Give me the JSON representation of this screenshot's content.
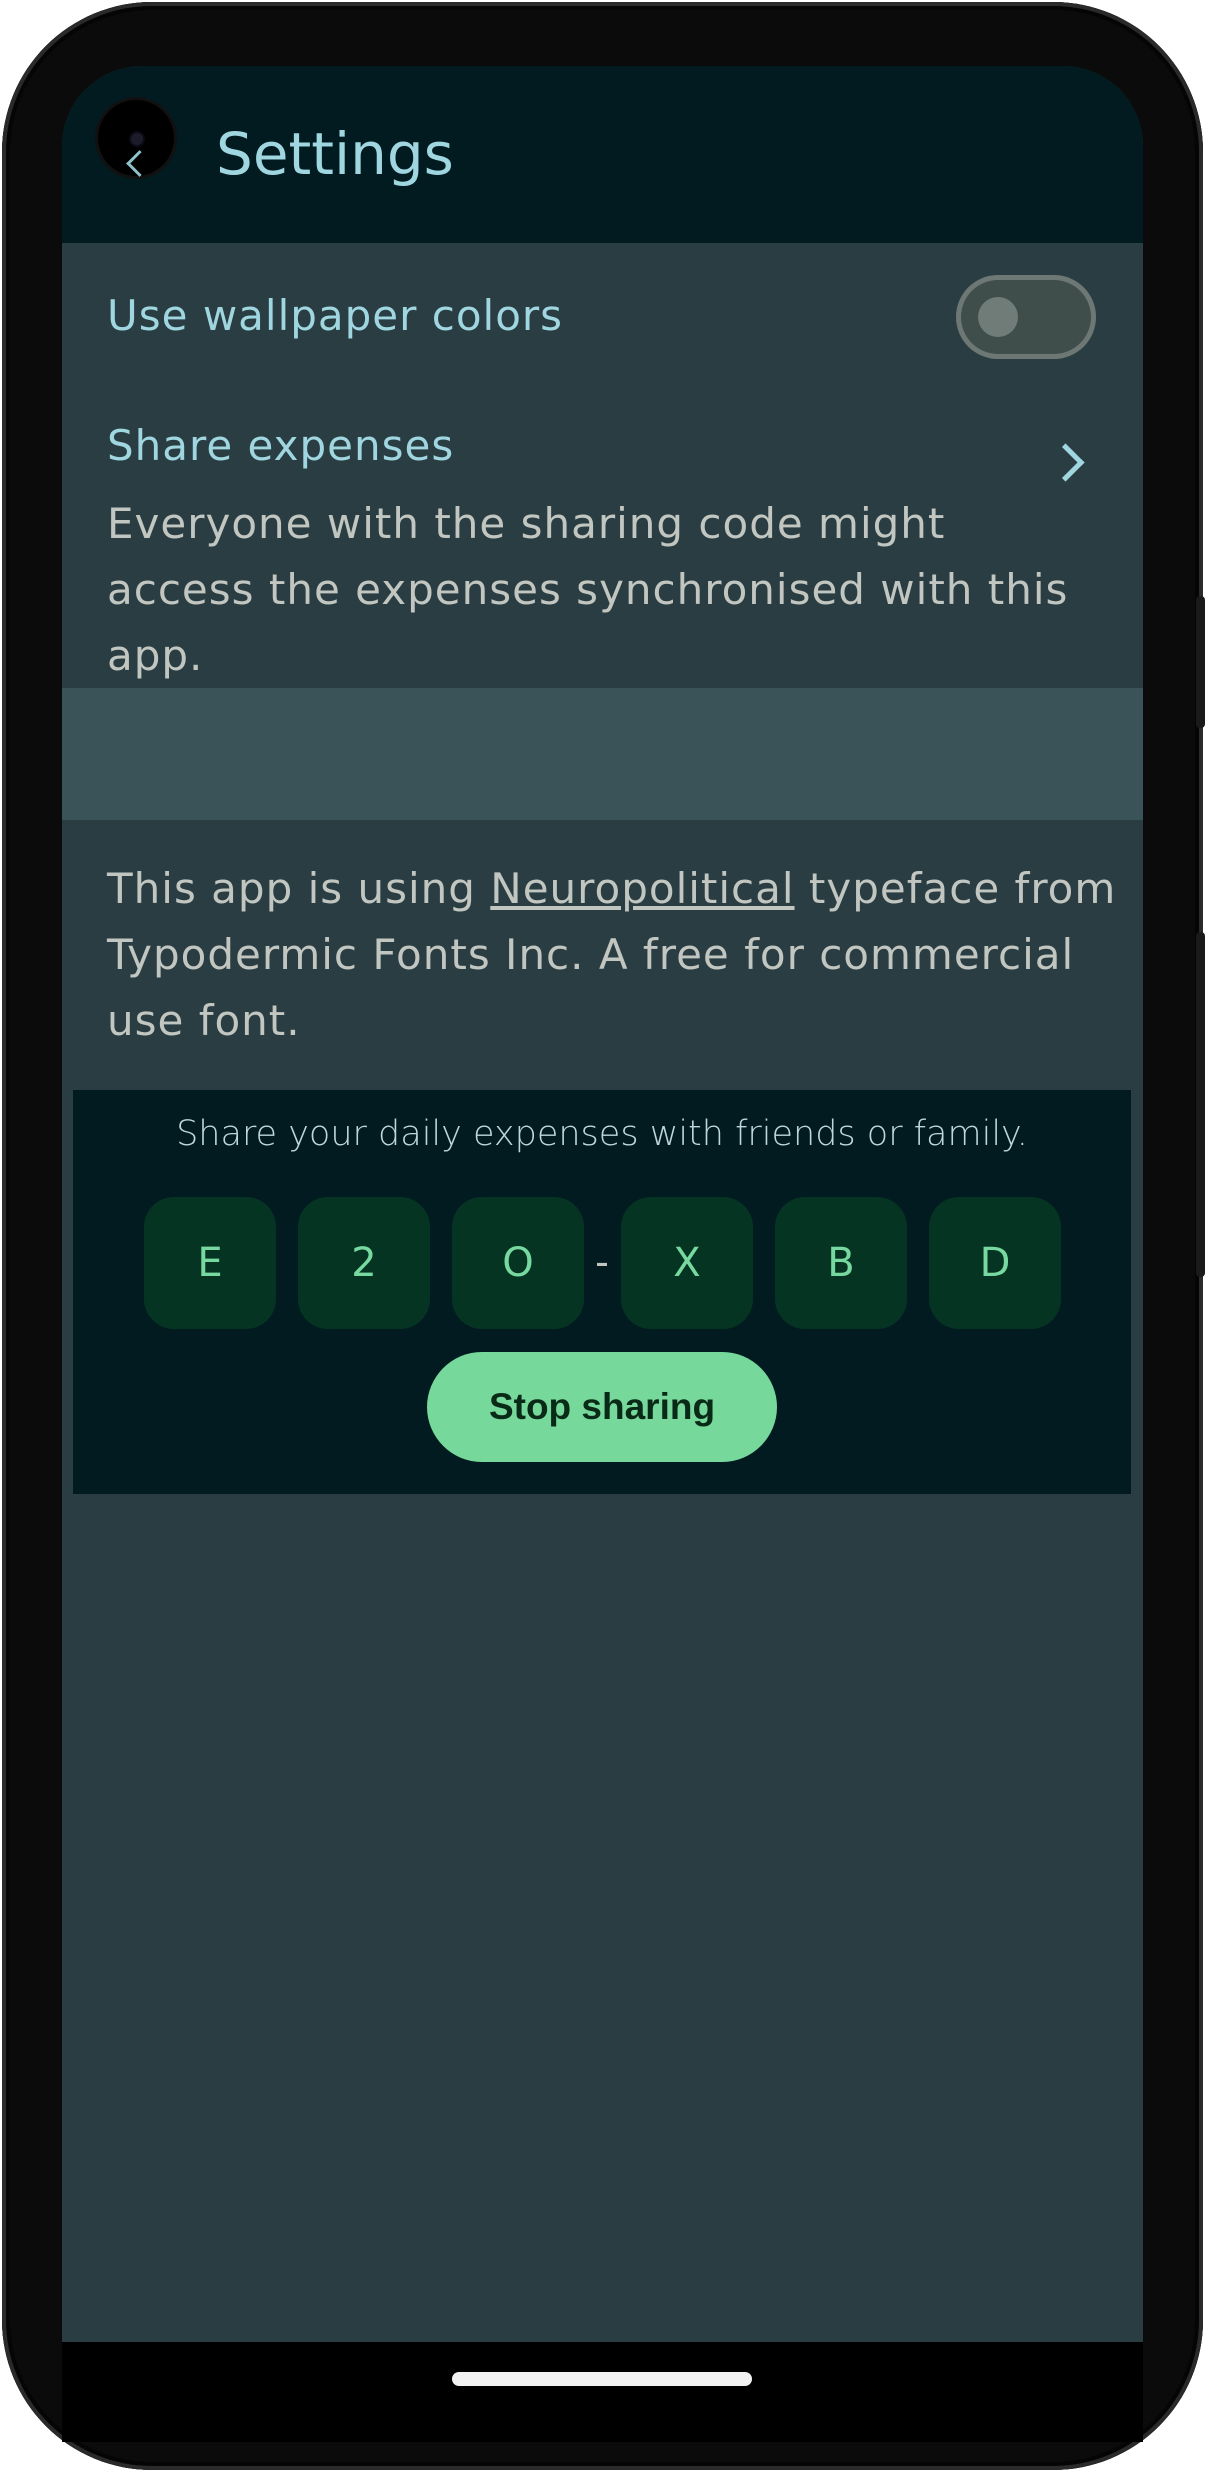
{
  "header": {
    "title": "Settings"
  },
  "settings": {
    "wallpaper_label": "Use wallpaper colors",
    "wallpaper_enabled": false,
    "share_label": "Share expenses",
    "share_description": "Everyone with the sharing code might access the expenses synchronised with this app."
  },
  "credit": {
    "prefix": "This app is using ",
    "link_text": "Neuropolitical",
    "suffix": " typeface from Typodermic Fonts Inc. A free for commercial use font."
  },
  "share_panel": {
    "caption": "Share your daily expenses with friends or family.",
    "code": [
      "E",
      "2",
      "O",
      "X",
      "B",
      "D"
    ],
    "separator": "-",
    "stop_label": "Stop sharing"
  },
  "colors": {
    "accent": "#9fd6e0",
    "button": "#76d89b",
    "code_box": "#053522"
  },
  "icons": [
    "camera-icon",
    "back-arrow-icon",
    "chevron-right-icon"
  ]
}
